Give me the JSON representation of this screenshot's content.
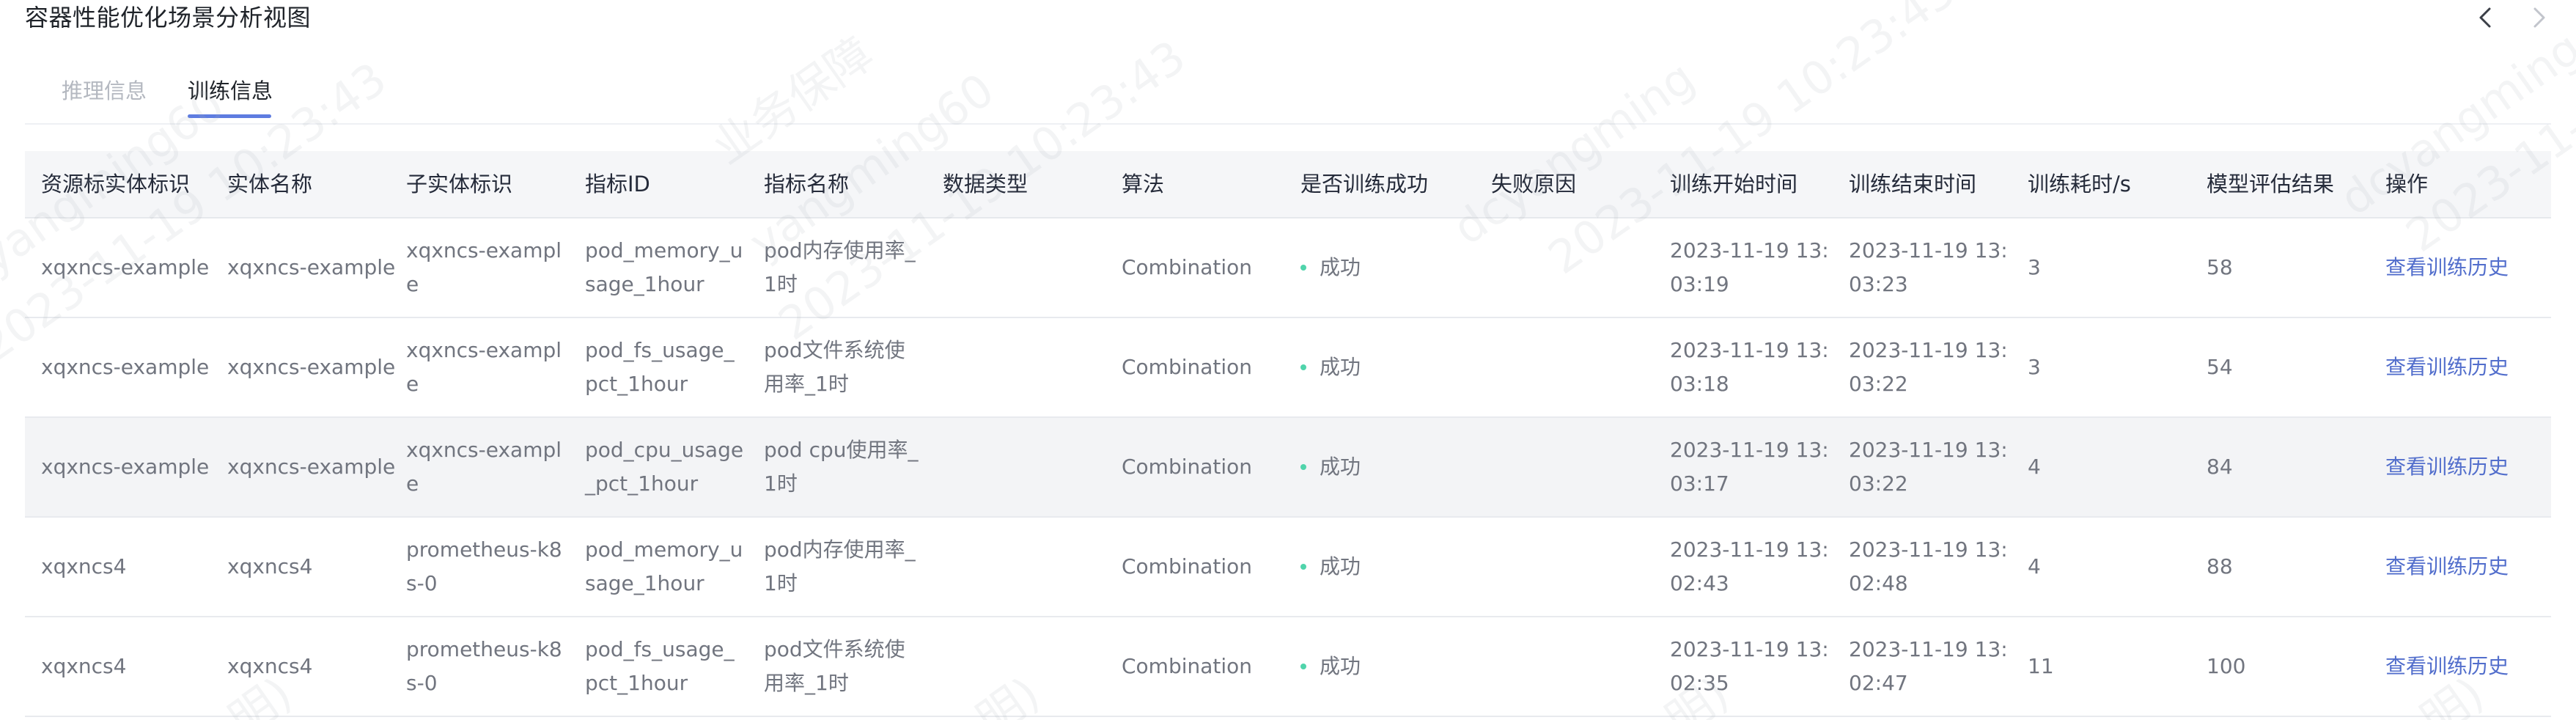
{
  "header": {
    "title": "容器性能优化场景分析视图"
  },
  "tabs": [
    {
      "label": "推理信息",
      "active": false
    },
    {
      "label": "训练信息",
      "active": true
    }
  ],
  "table": {
    "columns": [
      "资源标实体标识",
      "实体名称",
      "子实体标识",
      "指标ID",
      "指标名称",
      "数据类型",
      "算法",
      "是否训练成功",
      "失败原因",
      "训练开始时间",
      "训练结束时间",
      "训练耗时/s",
      "模型评估结果",
      "操作"
    ],
    "rows": [
      {
        "resource_id": "xqxncs-example",
        "entity_name": "xqxncs-example",
        "sub_entity_id": "xqxncs-example",
        "metric_id": "pod_memory_usage_1hour",
        "metric_name": "pod内存使用率_1时",
        "data_type": "",
        "algorithm": "Combination",
        "success": "成功",
        "fail_reason": "",
        "start_time": "2023-11-19 13:03:19",
        "end_time": "2023-11-19 13:03:23",
        "duration": "3",
        "eval_result": "58",
        "action": "查看训练历史"
      },
      {
        "resource_id": "xqxncs-example",
        "entity_name": "xqxncs-example",
        "sub_entity_id": "xqxncs-example",
        "metric_id": "pod_fs_usage_pct_1hour",
        "metric_name": "pod文件系统使用率_1时",
        "data_type": "",
        "algorithm": "Combination",
        "success": "成功",
        "fail_reason": "",
        "start_time": "2023-11-19 13:03:18",
        "end_time": "2023-11-19 13:03:22",
        "duration": "3",
        "eval_result": "54",
        "action": "查看训练历史"
      },
      {
        "resource_id": "xqxncs-example",
        "entity_name": "xqxncs-example",
        "sub_entity_id": "xqxncs-example",
        "metric_id": "pod_cpu_usage_pct_1hour",
        "metric_name": "pod cpu使用率_1时",
        "data_type": "",
        "algorithm": "Combination",
        "success": "成功",
        "fail_reason": "",
        "start_time": "2023-11-19 13:03:17",
        "end_time": "2023-11-19 13:03:22",
        "duration": "4",
        "eval_result": "84",
        "action": "查看训练历史"
      },
      {
        "resource_id": "xqxncs4",
        "entity_name": "xqxncs4",
        "sub_entity_id": "prometheus-k8s-0",
        "metric_id": "pod_memory_usage_1hour",
        "metric_name": "pod内存使用率_1时",
        "data_type": "",
        "algorithm": "Combination",
        "success": "成功",
        "fail_reason": "",
        "start_time": "2023-11-19 13:02:43",
        "end_time": "2023-11-19 13:02:48",
        "duration": "4",
        "eval_result": "88",
        "action": "查看训练历史"
      },
      {
        "resource_id": "xqxncs4",
        "entity_name": "xqxncs4",
        "sub_entity_id": "prometheus-k8s-0",
        "metric_id": "pod_fs_usage_pct_1hour",
        "metric_name": "pod文件系统使用率_1时",
        "data_type": "",
        "algorithm": "Combination",
        "success": "成功",
        "fail_reason": "",
        "start_time": "2023-11-19 13:02:35",
        "end_time": "2023-11-19 13:02:47",
        "duration": "11",
        "eval_result": "100",
        "action": "查看训练历史"
      }
    ]
  },
  "watermark": {
    "user": "dcyangming",
    "datetime": "2023-11-19 10:23:43",
    "company_text": "业务保障",
    "user_code": "yangming60",
    "paren_fragment": "明)"
  },
  "icons": {
    "prev": "chevron-left-icon",
    "next": "chevron-right-icon"
  },
  "colors": {
    "accent": "#5e7ce0",
    "link": "#526ecc",
    "success_dot": "#50d4ab",
    "header_bg": "#f5f6f8",
    "row_alt_bg": "#f3f4f6"
  }
}
